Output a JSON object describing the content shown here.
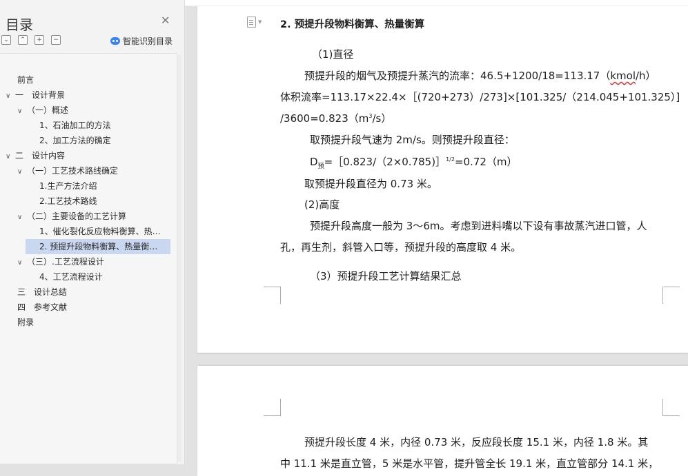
{
  "sidebar": {
    "title": "目录",
    "close_icon": "close-icon",
    "tools": [
      {
        "icon": "collapse-all-icon",
        "glyph": "⌄"
      },
      {
        "icon": "expand-up-icon",
        "glyph": "⌃"
      },
      {
        "icon": "plus-icon",
        "glyph": "+"
      },
      {
        "icon": "minus-icon",
        "glyph": "−"
      }
    ],
    "smart_toc_label": "智能识别目录",
    "toc": [
      {
        "label": "前言",
        "expanded": null
      },
      {
        "label": "一　设计背景",
        "expanded": true
      },
      {
        "label": "（一）概述",
        "expanded": true
      },
      {
        "label": "1、石油加工的方法",
        "expanded": null
      },
      {
        "label": "2、加工方法的确定",
        "expanded": null
      },
      {
        "label": "二　设计内容",
        "expanded": true
      },
      {
        "label": "（一）工艺技术路线确定",
        "expanded": true
      },
      {
        "label": "1.生产方法介绍",
        "expanded": null
      },
      {
        "label": "2.工艺技术路线",
        "expanded": null
      },
      {
        "label": "（二）主要设备的工艺计算",
        "expanded": true
      },
      {
        "label": "1、催化裂化反应物料衡算、热…",
        "expanded": null
      },
      {
        "label": "2. 预提升段物料衡算、热量衡…",
        "expanded": null,
        "selected": true
      },
      {
        "label": "（三）.工艺流程设计",
        "expanded": true
      },
      {
        "label": "4、工艺流程设计",
        "expanded": null
      },
      {
        "label": "三　设计总结",
        "expanded": null
      },
      {
        "label": "四　参考文献",
        "expanded": null
      },
      {
        "label": "附录",
        "expanded": null
      }
    ],
    "colors": {
      "selected": "#c9d7f0",
      "accent": "#3b82f6"
    }
  },
  "document": {
    "heading": "2.  预提升段物料衡算、热量衡算",
    "sub1": "（1)直径",
    "p1_a": "预提升段的烟气及预提升蒸汽的流率：46.5+1200/18=113.17（",
    "p1_unit": "kmol",
    "p1_b": "/h）",
    "p2": "体积流率=113.17×22.4×［(720+273）/273]×[101.325/（214.045+101.325）]",
    "p3_a": "/3600=0.823（m",
    "p3_sup": "3",
    "p3_b": "/s）",
    "p4": "取预提升段气速为 2m/s。则预提升段直径：",
    "p5_a": "D",
    "p5_sub": "预",
    "p5_b": "=［0.823/（2×0.785)］",
    "p5_sup": "1/2",
    "p5_c": "=0.72（m）",
    "p6": "取预提升段直径为 0.73 米。",
    "sub2": "(2)高度",
    "p7": "预提升段高度一般为 3～6m。考虑到进料嘴以下设有事故蒸汽进口管，人",
    "p8": "孔，再生剂，斜管入口等，预提升段的高度取 4 米。",
    "sub3": "（3）预提升段工艺计算结果汇总",
    "p9": "预提升段长度 4 米，内径 0.73 米，反应段长度 15.1 米，内径 1.8 米。其",
    "p10": "中 11.1 米是直立管，5 米是水平管，提升管全长 19.1 米，直立管部分 14.1 米，"
  }
}
